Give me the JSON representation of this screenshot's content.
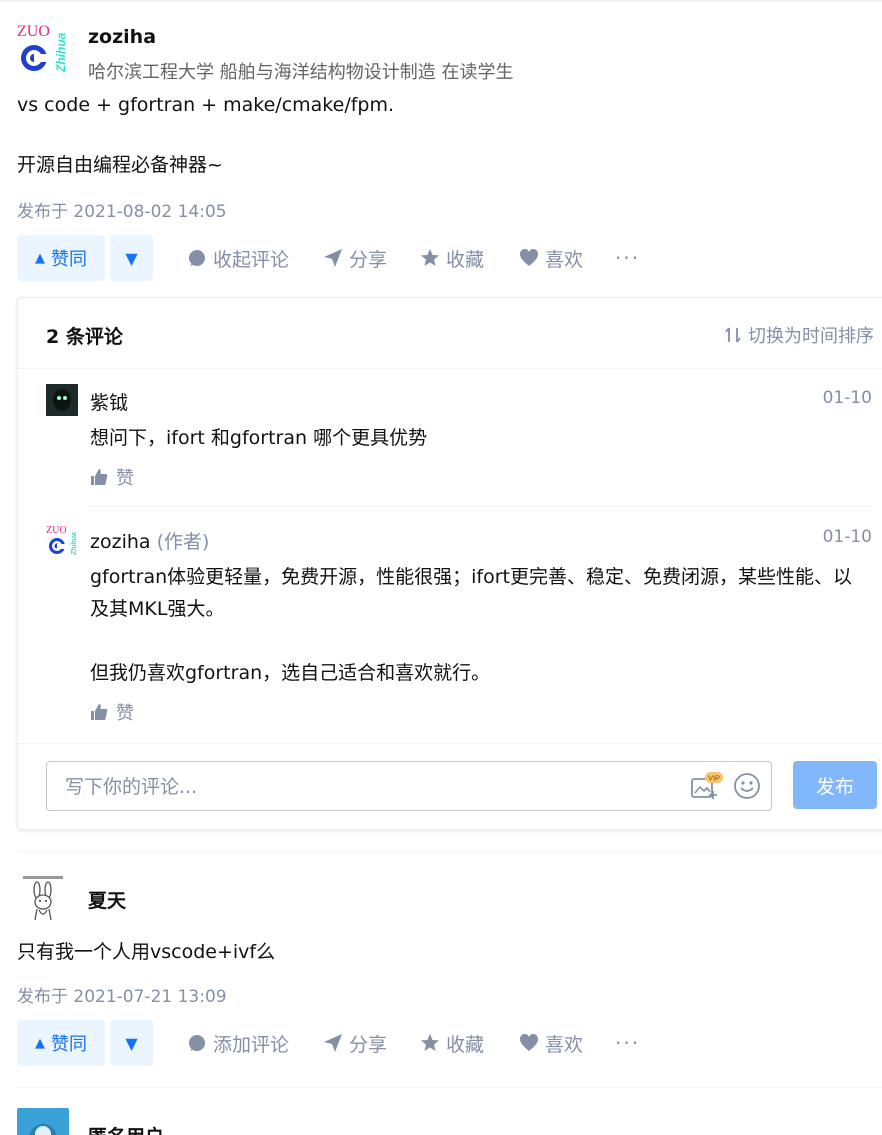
{
  "answers": [
    {
      "author_name": "zoziha",
      "author_headline": "哈尔滨工程大学 船舶与海洋结构物设计制造 在读学生",
      "avatar_text_top": "ZUO",
      "avatar_text_side": "Zhihua",
      "content": [
        "vs code + gfortran + make/cmake/fpm.",
        "开源自由编程必备神器~"
      ],
      "published": "发布于 2021-08-02 14:05",
      "actions": {
        "vote_up": "赞同",
        "comment": "收起评论",
        "share": "分享",
        "collect": "收藏",
        "like": "喜欢",
        "more": "···"
      }
    },
    {
      "author_name": "夏天",
      "content": [
        "只有我一个人用vscode+ivf么"
      ],
      "published": "发布于 2021-07-21 13:09",
      "actions": {
        "vote_up": "赞同",
        "comment": "添加评论",
        "share": "分享",
        "collect": "收藏",
        "like": "喜欢",
        "more": "···"
      }
    },
    {
      "author_name": "匿名用户"
    }
  ],
  "comments": {
    "count_label": "2 条评论",
    "sort_label": "切换为时间排序",
    "items": [
      {
        "name": "紫钺",
        "role": "",
        "time": "01-10",
        "body": [
          "想问下，ifort 和gfortran 哪个更具优势"
        ],
        "like": "赞"
      },
      {
        "name": "zoziha",
        "role": "(作者)",
        "time": "01-10",
        "body": [
          "gfortran体验更轻量，免费开源，性能很强；ifort更完善、稳定、免费闭源，某些性能、以及其MKL强大。",
          "但我仍喜欢gfortran，选自己适合和喜欢就行。"
        ],
        "like": "赞"
      }
    ],
    "input_placeholder": "写下你的评论...",
    "vip_badge": "VIP",
    "submit_label": "发布"
  },
  "colors": {
    "accent": "#1772f6",
    "muted": "#8590a6",
    "submit": "#81b7fb"
  }
}
